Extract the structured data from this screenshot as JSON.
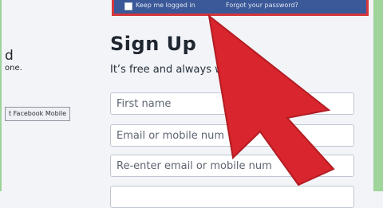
{
  "header": {
    "keep_logged_in_label": "Keep me logged in",
    "forgot_password_link": "Forgot your password?"
  },
  "left_panel": {
    "partial_heading": "d",
    "partial_line": "one.",
    "mobile_button": "t Facebook Mobile"
  },
  "signup": {
    "title": "Sign Up",
    "subtitle": "It’s free and always w",
    "fields": [
      {
        "placeholder": "First name"
      },
      {
        "placeholder": "Email or mobile num"
      },
      {
        "placeholder": "Re-enter email or mobile num"
      },
      {
        "placeholder": ""
      }
    ]
  },
  "colors": {
    "facebook_blue": "#3b5998",
    "highlight_red": "#d6363c",
    "page_background": "#f2f4f8"
  },
  "icons": {
    "pointer": "red-arrow-icon",
    "checkbox": "checkbox-icon"
  }
}
